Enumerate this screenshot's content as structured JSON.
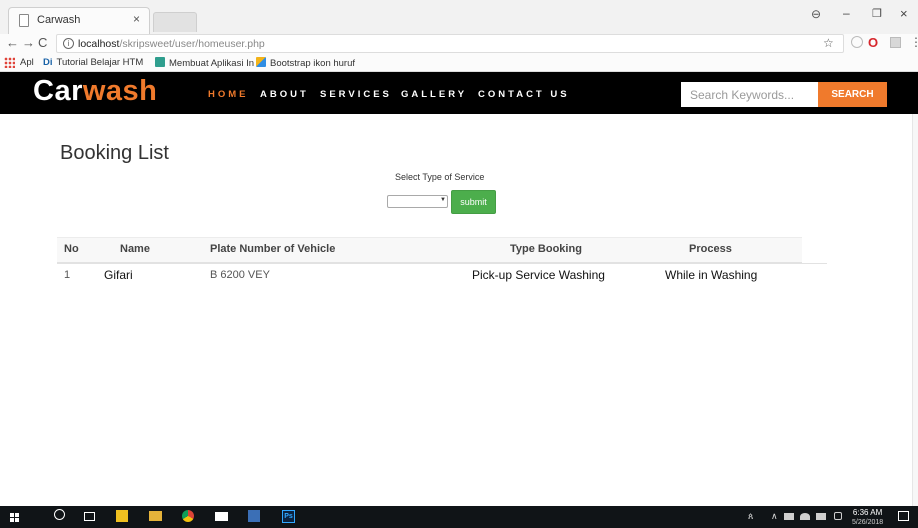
{
  "browser": {
    "tab_title": "Carwash",
    "tab_close": "×",
    "url_host": "localhost",
    "url_path": "/skripsweet/user/homeuser.php",
    "window_controls": {
      "account": "⊖",
      "minimize": "–",
      "maximize": "❐",
      "close": "×"
    },
    "nav": {
      "back": "←",
      "forward": "→",
      "reload": "C"
    },
    "bookmarks": [
      {
        "label": "Apl",
        "icon": "apps-grid-icon",
        "color": "#e0443a"
      },
      {
        "label": "Tutorial Belajar HTM",
        "icon": "di-icon",
        "prefix": "Di",
        "color": "#1a63a8"
      },
      {
        "label": "Membuat Aplikasi In",
        "icon": "doc-icon",
        "color": "#2f9e8e"
      },
      {
        "label": "Bootstrap ikon huruf",
        "icon": "colorful-icon",
        "color": "#f2b319"
      }
    ]
  },
  "site": {
    "logo_part1": "Car",
    "logo_part2": "wash",
    "nav": [
      {
        "label": "HOME",
        "active": true
      },
      {
        "label": "ABOUT",
        "active": false
      },
      {
        "label": "SERVICES",
        "active": false
      },
      {
        "label": "GALLERY",
        "active": false
      },
      {
        "label": "CONTACT US",
        "active": false
      }
    ],
    "search": {
      "placeholder": "Search Keywords...",
      "button": "SEARCH"
    },
    "colors": {
      "accent": "#f07a2c",
      "header_bg": "#000000",
      "submit_green": "#4cae4c"
    }
  },
  "main": {
    "title": "Booking List",
    "filter_label": "Select Type of Service",
    "select_value": "",
    "submit_label": "submit",
    "table": {
      "headers": [
        "No",
        "Name",
        "Plate Number of Vehicle",
        "Type Booking",
        "Process"
      ],
      "rows": [
        [
          "1",
          "Gifari",
          "B 6200 VEY",
          "Pick-up Service Washing",
          "While in Washing"
        ]
      ]
    }
  },
  "taskbar": {
    "icons": [
      "windows-start-icon",
      "search-icon",
      "task-view-icon",
      "store-icon",
      "file-explorer-icon",
      "chrome-icon",
      "mail-icon",
      "photos-icon",
      "photoshop-icon"
    ],
    "photoshop_label": "Ps",
    "tray_people": "ጰ",
    "tray_chevron": "∧",
    "time": "6:36 AM",
    "date": "5/26/2018"
  }
}
